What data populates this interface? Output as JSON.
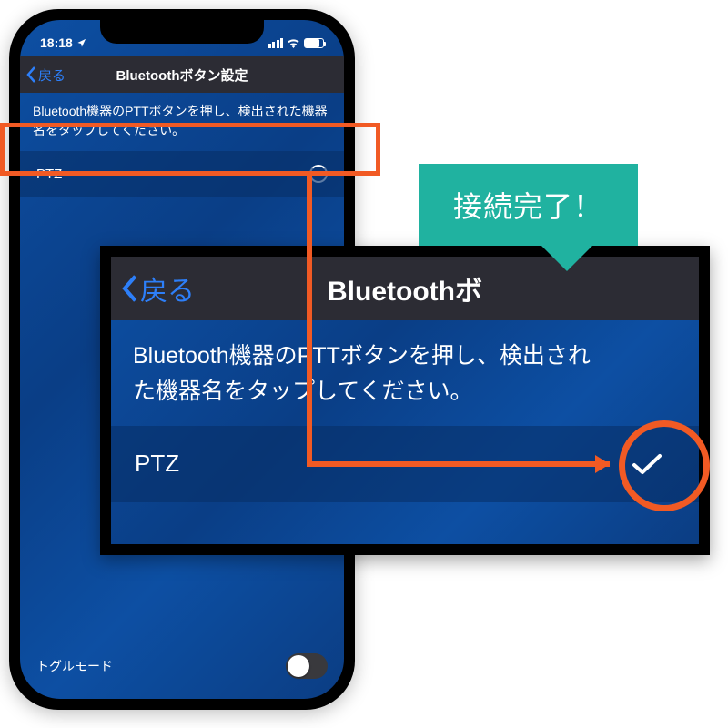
{
  "status": {
    "time": "18:18"
  },
  "nav": {
    "back": "戻る",
    "title": "Bluetoothボタン設定"
  },
  "instructions": "Bluetooth機器のPTTボタンを押し、検出された機器名をタップしてください。",
  "device": {
    "name": "PTZ"
  },
  "toggle": {
    "label": "トグルモード"
  },
  "zoom": {
    "nav_back": "戻る",
    "nav_title_truncated": "Bluetoothボ",
    "instructions_l1": "Bluetooth機器のPTTボタンを押し、検出され",
    "instructions_l2": "た機器名をタップしてください。",
    "device_name": "PTZ"
  },
  "callout": {
    "text": "接続完了！"
  }
}
